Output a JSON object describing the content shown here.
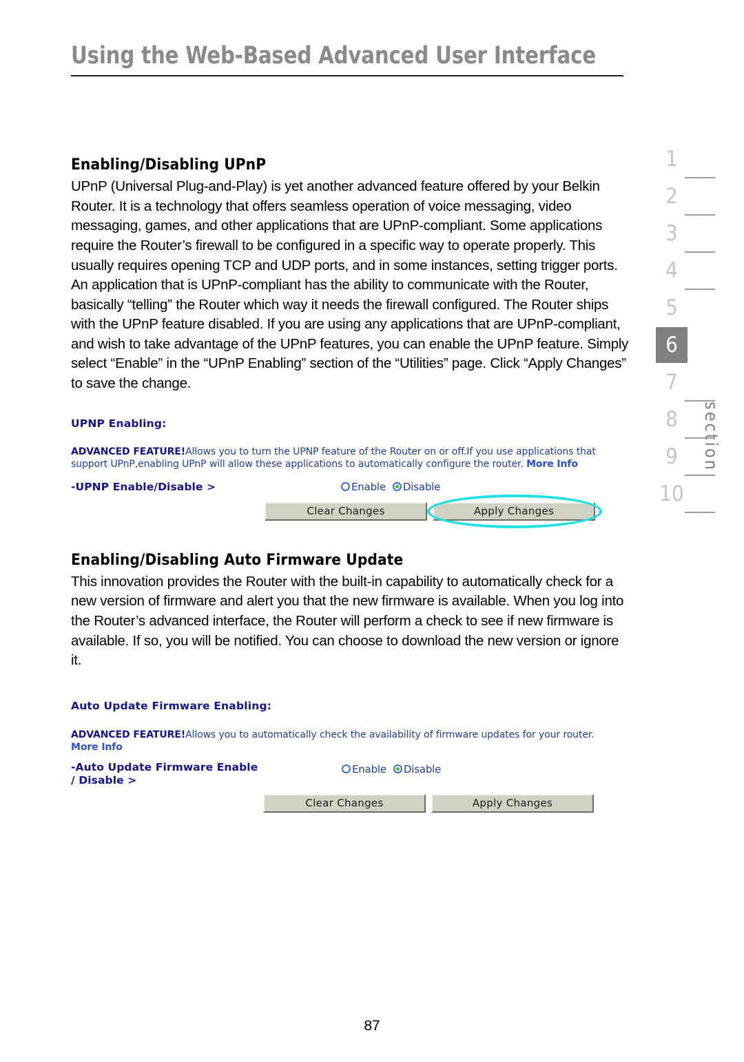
{
  "header": {
    "title": "Using the Web-Based Advanced User Interface"
  },
  "sections": [
    {
      "heading": "Enabling/Disabling UPnP",
      "paragraph": "UPnP (Universal Plug-and-Play) is yet another advanced feature offered by your Belkin Router. It is a technology that offers seamless operation of voice messaging, video messaging, games, and other applications that are UPnP-compliant. Some applications require the Router’s firewall to be configured in a specific way to operate properly. This usually requires opening TCP and UDP ports, and in some instances, setting trigger ports. An application that is UPnP-compliant has the ability to communicate with the Router, basically “telling” the Router which way it needs the firewall configured. The Router ships with the UPnP feature disabled. If you are using any applications that are UPnP-compliant, and wish to take advantage of the UPnP features, you can enable the UPnP feature. Simply select “Enable” in the “UPnP Enabling” section of the “Utilities” page. Click “Apply Changes” to save the change."
    },
    {
      "heading": "Enabling/Disabling Auto Firmware Update",
      "paragraph": "This innovation provides the Router with the built-in capability to automatically check for a new version of firmware and alert you that the new firmware is available. When you log into the Router’s advanced interface, the Router will perform a check to see if new firmware is available. If so, you will be notified. You can choose to download the new version or ignore it."
    }
  ],
  "ui_upnp": {
    "title": "UPNP Enabling:",
    "advanced_label": "ADVANCED FEATURE!",
    "description": "Allows you to turn the UPNP feature of the Router on or off.If you use applications that support UPnP,enabling UPnP will allow these applications to automatically configure the router. ",
    "more_info": "More Info",
    "field_label": "-UPNP Enable/Disable >",
    "radio_enable": "Enable",
    "radio_disable": "Disable",
    "selected": "Disable",
    "clear_button": "Clear Changes",
    "apply_button": "Apply Changes"
  },
  "ui_firmware": {
    "title": "Auto Update Firmware Enabling:",
    "advanced_label": "ADVANCED FEATURE!",
    "description": "Allows you to automatically check the availability of firmware updates for your router. ",
    "more_info": "More Info",
    "field_label_line1": "-Auto Update Firmware Enable",
    "field_label_line2": "/ Disable >",
    "radio_enable": "Enable",
    "radio_disable": "Disable",
    "selected": "Disable",
    "clear_button": "Clear Changes",
    "apply_button": "Apply Changes"
  },
  "section_rail": {
    "numbers": [
      "1",
      "2",
      "3",
      "4",
      "5",
      "6",
      "7",
      "8",
      "9",
      "10"
    ],
    "active": "6",
    "word": "section"
  },
  "footer": {
    "page_number": "87"
  },
  "colors": {
    "header_gray": "#8a8a8a",
    "ui_navy": "#14148c",
    "ui_link_blue": "#2b4fd0",
    "radio_green": "#2fbf2f",
    "annotation_cyan": "#1fe0e0",
    "rail_active_bg": "#808080",
    "button_face": "#ced3c4"
  }
}
